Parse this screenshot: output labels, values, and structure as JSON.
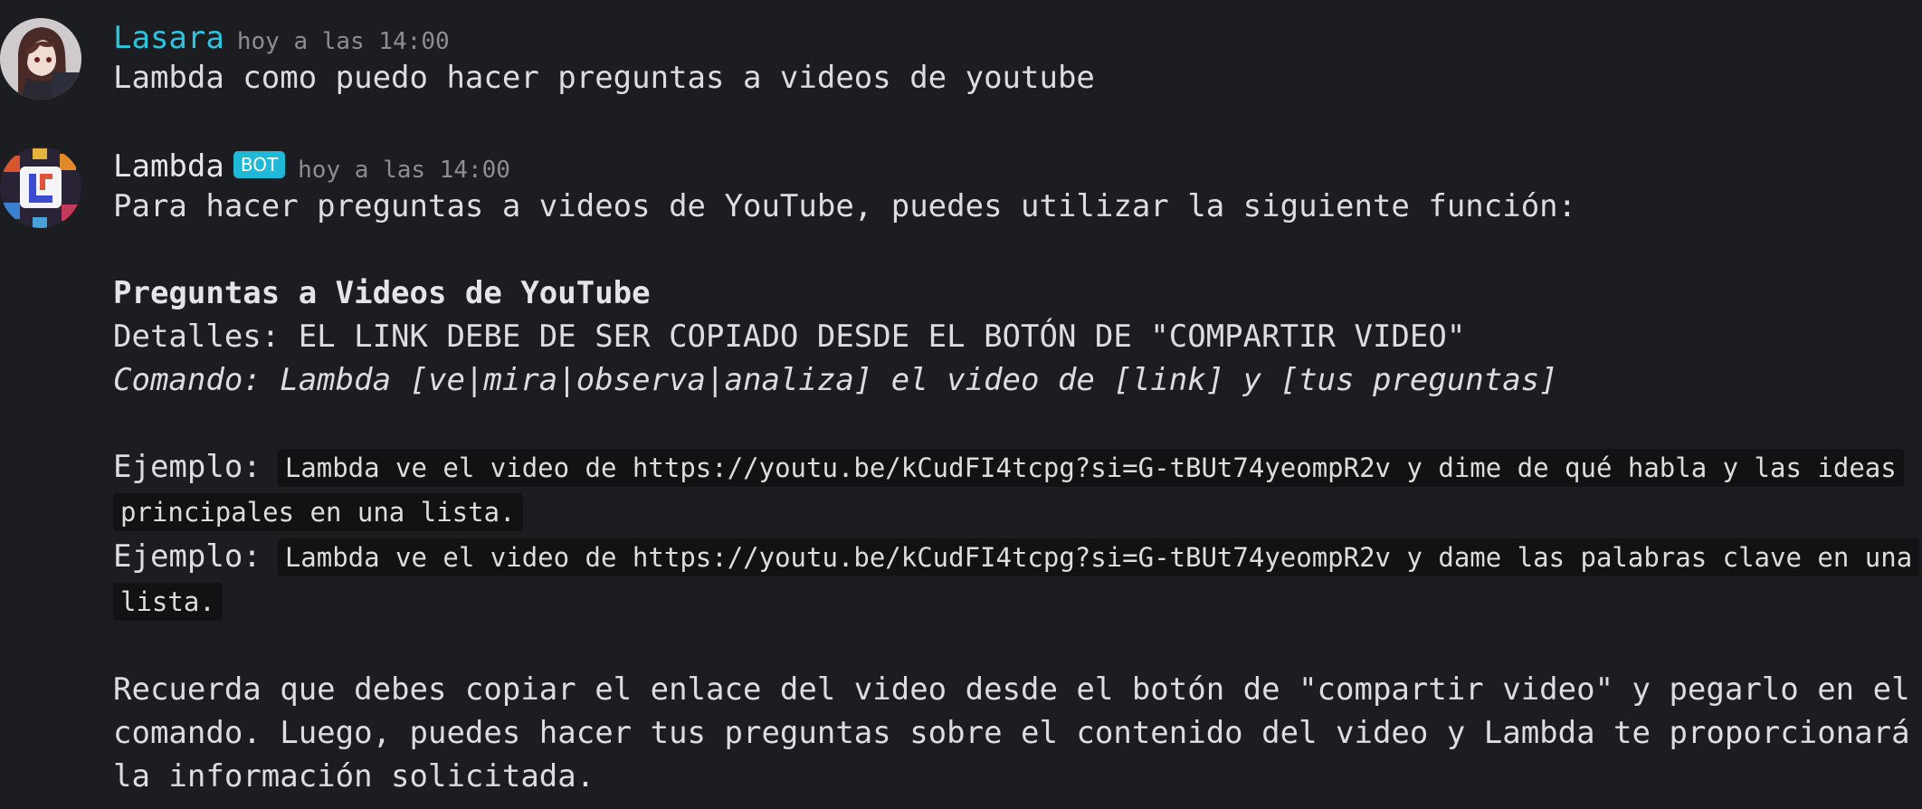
{
  "messages": {
    "user": {
      "username": "Lasara",
      "timestamp": "hoy a las 14:00",
      "text": "Lambda como puedo hacer preguntas a videos de youtube",
      "name_color": "#2cc5df"
    },
    "bot": {
      "username": "Lambda",
      "bot_tag": "BOT",
      "timestamp": "hoy a las 14:00",
      "intro": "Para hacer preguntas a videos de YouTube, puedes utilizar la siguiente función:",
      "heading": "Preguntas a Videos de YouTube",
      "details": "Detalles: EL LINK DEBE DE SER COPIADO DESDE EL BOTÓN DE \"COMPARTIR VIDEO\"",
      "command": "Comando: Lambda [ve|mira|observa|analiza] el video de [link] y [tus preguntas]",
      "example_label": "Ejemplo:",
      "example_1": "Lambda ve el video de https://youtu.be/kCudFI4tcpg?si=G-tBUt74yeompR2v y dime de qué habla y las ideas principales en una lista.",
      "example_2": "Lambda ve el video de https://youtu.be/kCudFI4tcpg?si=G-tBUt74yeompR2v y dame las palabras clave en una lista.",
      "closing": "Recuerda que debes copiar el enlace del video desde el botón de \"compartir video\" y pegarlo en el comando. Luego, puedes hacer tus preguntas sobre el contenido del video y Lambda te proporcionará la información solicitada.",
      "tag_color": "#1fb8d6"
    }
  },
  "theme": {
    "background": "#1b1d20",
    "text": "#dcdde0",
    "timestamp": "#8b8e94",
    "code_background": "#101214"
  }
}
